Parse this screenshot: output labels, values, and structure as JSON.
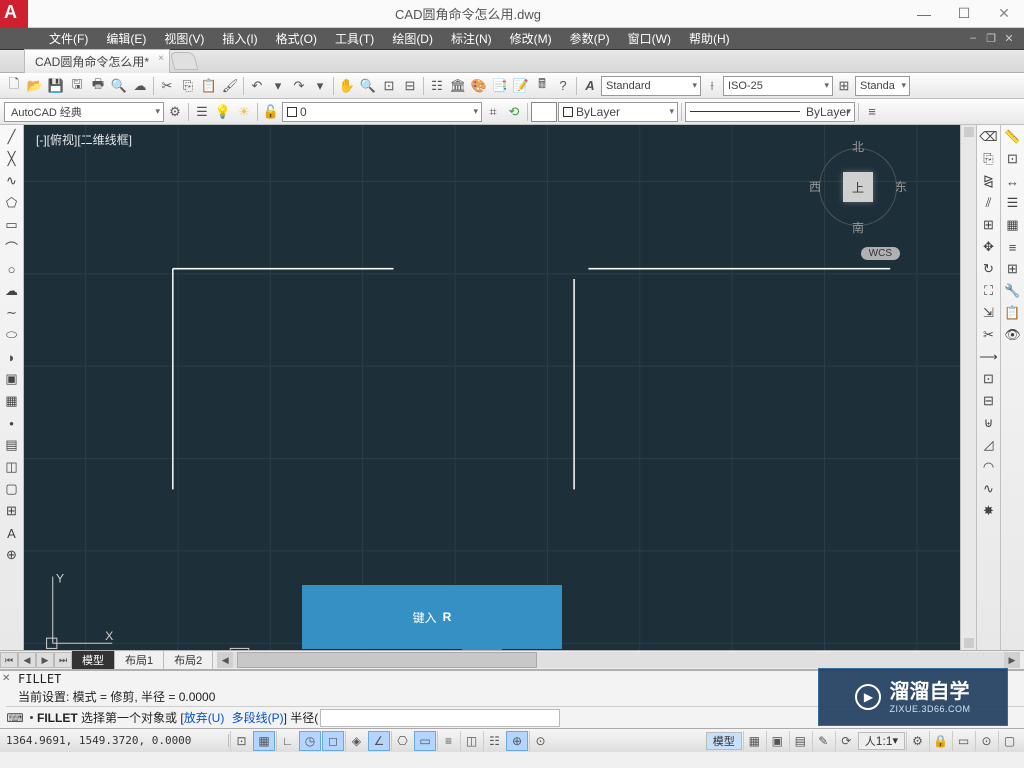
{
  "window": {
    "title": "CAD圆角命令怎么用.dwg",
    "min": "—",
    "max": "☐",
    "close": "✕"
  },
  "menu": {
    "file": "文件(F)",
    "edit": "编辑(E)",
    "view": "视图(V)",
    "insert": "插入(I)",
    "format": "格式(O)",
    "tools": "工具(T)",
    "draw": "绘图(D)",
    "dim": "标注(N)",
    "modify": "修改(M)",
    "param": "参数(P)",
    "window": "窗口(W)",
    "help": "帮助(H)"
  },
  "doc_tab": {
    "name": "CAD圆角命令怎么用*",
    "close": "×"
  },
  "toolbar": {
    "text_style": "Standard",
    "dim_style": "ISO-25",
    "table_style": "Standa"
  },
  "workspace": {
    "current": "AutoCAD 经典"
  },
  "layer": {
    "combo_zero": "0",
    "bylayer": "ByLayer",
    "lineweight_label": "ByLayer"
  },
  "canvas": {
    "label": "[-][俯视][二维线框]",
    "viewcube": {
      "face": "上",
      "n": "北",
      "s": "南",
      "w": "西",
      "e": "东",
      "wcs": "WCS"
    },
    "axis_x": "X",
    "axis_y": "Y"
  },
  "callout": {
    "text": "键入",
    "key": "R"
  },
  "layout_tabs": {
    "model": "模型",
    "layout1": "布局1",
    "layout2": "布局2"
  },
  "command": {
    "line1": "FILLET",
    "line2_prefix": "当前设置: 模式 = 修剪, 半径 = ",
    "line2_value": "0.0000",
    "prompt_cmd": "FILLET",
    "prompt_text1": " 选择第一个对象或 [",
    "prompt_opt_u": "放弃(U)",
    "prompt_opt_p": "多段线(P)",
    "prompt_text2": "] 半径("
  },
  "status": {
    "coords": "1364.9691, 1549.3720, 0.0000",
    "model_btn": "模型",
    "scale": "1:1"
  },
  "watermark": {
    "main": "溜溜自学",
    "sub": "ZIXUE.3D66.COM"
  }
}
